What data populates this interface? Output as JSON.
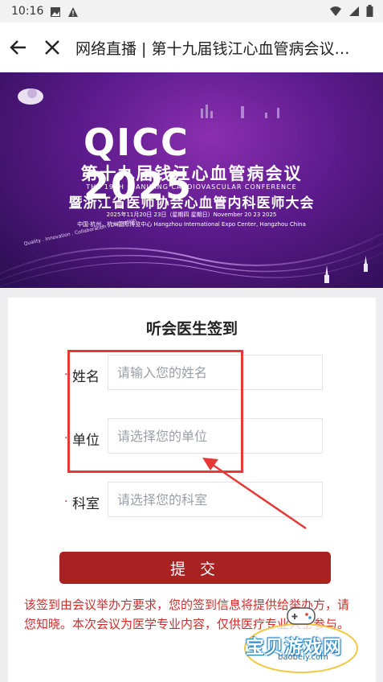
{
  "status_bar": {
    "time": "10:16",
    "icons": [
      "image-icon",
      "alert-icon",
      "wifi-icon",
      "signal-icon",
      "battery-icon"
    ]
  },
  "header": {
    "back_icon": "arrow-left-icon",
    "close_icon": "close-icon",
    "title": "网络直播 | 第十九届钱江心血管病会议…"
  },
  "banner": {
    "brand": "QICC 2025",
    "title_cn": "第十九届钱江心血管病会议",
    "title_en": "THE 19TH QIANJIANG CARDIOVASCULAR CONFERENCE",
    "subtitle_cn": "暨浙江省医师协会心血管内科医师大会",
    "date": "2025年11月20日 23日（星期四 星期日）November 20 23 2025",
    "place": "中国·杭州，杭州国际博览中心 Hangzhou International Expo Center, Hangzhou China",
    "motto": "Quality . Innovation . Collaboration . Cultivation"
  },
  "form": {
    "title": "听会医生签到",
    "fields": [
      {
        "label": "姓名",
        "placeholder": "请输入您的姓名",
        "value": ""
      },
      {
        "label": "单位",
        "placeholder": "请选择您的单位",
        "value": ""
      },
      {
        "label": "科室",
        "placeholder": "请选择您的科室",
        "value": ""
      }
    ],
    "required_mark": "·",
    "submit_label": "提 交",
    "notice": "该签到由会议举办方要求，您的签到信息将提供给举办方，请您知晓。本次会议为医学专业内容，仅供医疗专业人士参与。"
  },
  "watermark": {
    "text": "宝贝游戏网",
    "url": "baobeiy.com"
  },
  "colors": {
    "accent": "#a82222",
    "notice_text": "#d22b2b",
    "highlight": "#e53935",
    "banner_purple": "#5a1a8a"
  }
}
